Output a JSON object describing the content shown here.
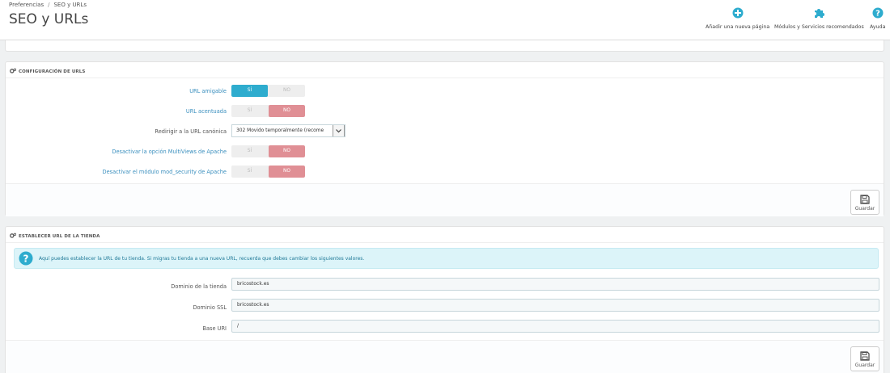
{
  "breadcrumb": {
    "parent": "Preferencias",
    "separator": "/",
    "current": "SEO y URLs"
  },
  "page_title": "SEO y URLs",
  "toolbar": {
    "add_page": "Añadir una nueva página",
    "modules": "Módulos y Servicios recomendados",
    "help": "Ayuda"
  },
  "url_config": {
    "heading": "CONFIGURACIÓN DE URLS",
    "rows": [
      {
        "label": "URL amigable",
        "yes": "SÍ",
        "no": "NO",
        "value": "yes"
      },
      {
        "label": "URL acentuada",
        "yes": "SÍ",
        "no": "NO",
        "value": "no"
      },
      {
        "label": "Redirigir a la URL canónica",
        "select_value": "302 Movido temporalmente (recome"
      },
      {
        "label": "Desactivar la opción MultiViews de Apache",
        "yes": "SÍ",
        "no": "NO",
        "value": "no"
      },
      {
        "label": "Desactivar el módulo mod_security de Apache",
        "yes": "SÍ",
        "no": "NO",
        "value": "no"
      }
    ],
    "save_label": "Guardar"
  },
  "shop_url": {
    "heading": "ESTABLECER URL DE LA TIENDA",
    "info": "Aquí puedes establecer la URL de tu tienda. Si migras tu tienda a una nueva URL, recuerda que debes cambiar los siguientes valores.",
    "fields": [
      {
        "label": "Dominio de la tienda",
        "value": "bricostock.es"
      },
      {
        "label": "Dominio SSL",
        "value": "bricostock.es"
      },
      {
        "label": "Base URI",
        "value": "/"
      }
    ],
    "save_label": "Guardar"
  },
  "colors": {
    "accent": "#2eacce",
    "no_active": "#e08f95",
    "help_label": "#3a8fbe",
    "alert_bg": "#dcf4f9"
  }
}
